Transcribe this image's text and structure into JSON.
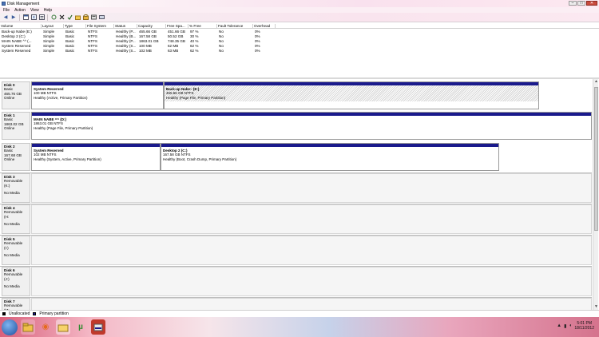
{
  "window": {
    "title": "Disk Management",
    "controls": {
      "minimize": "–",
      "maximize": "□",
      "close": "✕"
    }
  },
  "menu": [
    "File",
    "Action",
    "View",
    "Help"
  ],
  "toolbar": {
    "icons": [
      "back-arrow-icon",
      "forward-arrow-icon",
      "console-icon",
      "help-icon",
      "properties-icon",
      "refresh-icon",
      "delete-icon",
      "check-icon",
      "open-folder-icon",
      "explore-icon",
      "format-icon",
      "disk-icon"
    ],
    "glyphs": {
      "back": "◀",
      "forward": "▶"
    }
  },
  "volume_list": {
    "columns": [
      "Volume",
      "Layout",
      "Type",
      "File System",
      "Status",
      "Capacity",
      "Free Spa...",
      "% Free",
      "Fault Tolerance",
      "Overhead"
    ],
    "rows": [
      [
        "Back-up Nabe (E:)",
        "Simple",
        "Basic",
        "NTFS",
        "Healthy (P...",
        "465.66 GB",
        "451.66 GB",
        "97 %",
        "No",
        "0%"
      ],
      [
        "Desktop 2 (C:)",
        "Simple",
        "Basic",
        "NTFS",
        "Healthy (B...",
        "167.58 GB",
        "50.52 GB",
        "30 %",
        "No",
        "0%"
      ],
      [
        "MAIN NABE ^^ (...",
        "Simple",
        "Basic",
        "NTFS",
        "Healthy (P...",
        "1863.01 GB",
        "748.35 GB",
        "40 %",
        "No",
        "0%"
      ],
      [
        "System Reserved",
        "Simple",
        "Basic",
        "NTFS",
        "Healthy (S...",
        "100 MB",
        "62 MB",
        "62 %",
        "No",
        "0%"
      ],
      [
        "System Reserved",
        "Simple",
        "Basic",
        "NTFS",
        "Healthy (S...",
        "102 MB",
        "63 MB",
        "62 %",
        "No",
        "0%"
      ]
    ]
  },
  "disks": [
    {
      "name": "Disk 0",
      "type": "Basic",
      "size": "465.76 GB",
      "status": "Online",
      "partitions": [
        {
          "name": "System Reserved",
          "size": "100 MB NTFS",
          "status": "Healthy (Active, Primary Partition)"
        },
        {
          "name": "Back-up Nabe~  (E:)",
          "size": "465.66 GB NTFS",
          "status": "Healthy (Page File, Primary Partition)"
        }
      ]
    },
    {
      "name": "Disk 1",
      "type": "Basic",
      "size": "1863.02 GB",
      "status": "Online",
      "partitions": [
        {
          "name": "MAIN NABE ^^  (D:)",
          "size": "1863.01 GB NTFS",
          "status": "Healthy (Page File, Primary Partition)"
        }
      ]
    },
    {
      "name": "Disk 2",
      "type": "Basic",
      "size": "167.68 GB",
      "status": "Online",
      "partitions": [
        {
          "name": "System Reserved",
          "size": "102 MB NTFS",
          "status": "Healthy (System, Active, Primary Partition)"
        },
        {
          "name": "Desktop 2  (C:)",
          "size": "167.58 GB NTFS",
          "status": "Healthy (Boot, Crash Dump, Primary Partition)"
        }
      ]
    },
    {
      "name": "Disk 3",
      "type": "Removable (K:)",
      "status": "No Media"
    },
    {
      "name": "Disk 4",
      "type": "Removable (H:",
      "status": "No Media"
    },
    {
      "name": "Disk 5",
      "type": "Removable (I:)",
      "status": "No Media"
    },
    {
      "name": "Disk 6",
      "type": "Removable (J:)",
      "status": "No Media"
    },
    {
      "name": "Disk 7",
      "type": "Removable (M:",
      "status": ""
    }
  ],
  "legend": {
    "unallocated": {
      "label": "Unallocated",
      "color": "#000000"
    },
    "primary": {
      "label": "Primary partition",
      "color": "#1a1a8c"
    }
  },
  "scrollbar": {
    "up": "▲",
    "down": "▼"
  },
  "taskbar": {
    "apps": [
      "windows-explorer-icon",
      "firefox-icon",
      "folder-icon",
      "utorrent-icon",
      "disk-management-icon"
    ],
    "glyphs": {
      "firefox": "◉",
      "utorrent": "µ"
    },
    "time": "5:01 PM",
    "date": "18/11/2012"
  }
}
